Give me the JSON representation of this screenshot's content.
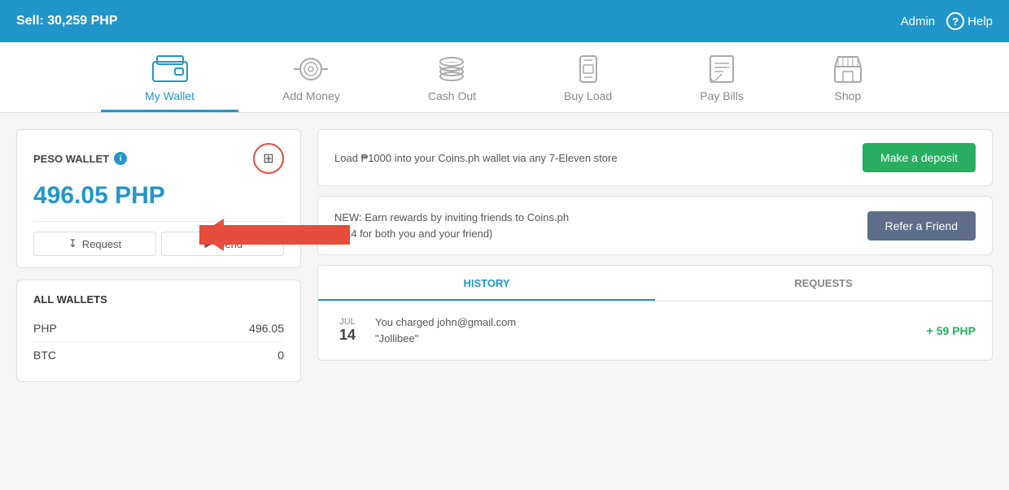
{
  "topbar": {
    "sell_label": "Sell: 30,259 PHP",
    "admin_label": "Admin",
    "help_label": "Help"
  },
  "nav": {
    "tabs": [
      {
        "id": "my-wallet",
        "label": "My Wallet",
        "active": true
      },
      {
        "id": "add-money",
        "label": "Add Money",
        "active": false
      },
      {
        "id": "cash-out",
        "label": "Cash Out",
        "active": false
      },
      {
        "id": "buy-load",
        "label": "Buy Load",
        "active": false
      },
      {
        "id": "pay-bills",
        "label": "Pay Bills",
        "active": false
      },
      {
        "id": "shop",
        "label": "Shop",
        "active": false
      }
    ]
  },
  "wallet": {
    "title": "PESO WALLET",
    "balance": "496.05 PHP",
    "request_label": "Request",
    "send_label": "Send"
  },
  "all_wallets": {
    "title": "ALL WALLETS",
    "rows": [
      {
        "currency": "PHP",
        "amount": "496.05"
      },
      {
        "currency": "BTC",
        "amount": "0"
      }
    ]
  },
  "banners": {
    "deposit": {
      "text": "Load ₱1000 into your Coins.ph wallet via any 7-Eleven store",
      "button": "Make a deposit"
    },
    "refer": {
      "text": "NEW: Earn rewards by inviting friends to Coins.ph\n(₱24 for both you and your friend)",
      "button": "Refer a Friend"
    }
  },
  "history": {
    "tab_history": "HISTORY",
    "tab_requests": "REQUESTS",
    "entries": [
      {
        "month": "JUL",
        "day": "14",
        "description": "You charged john@gmail.com\n\"Jollibee\"",
        "amount": "+ 59 PHP"
      }
    ]
  }
}
